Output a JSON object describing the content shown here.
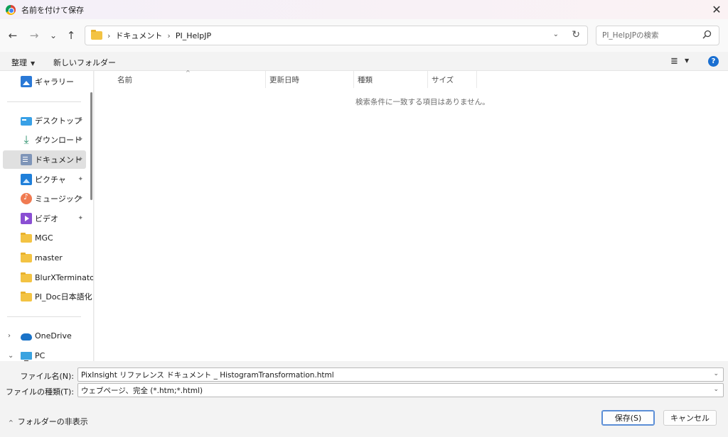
{
  "window": {
    "title": "名前を付けて保存",
    "close_glyph": "✕"
  },
  "nav": {
    "back_glyph": "←",
    "forward_glyph": "→",
    "recent_glyph": "⌄",
    "up_glyph": "↑",
    "breadcrumb": [
      "ドキュメント",
      "PI_HelpJP"
    ],
    "breadcrumb_sep": "›",
    "dropdown_glyph": "⌄",
    "refresh_glyph": "↻"
  },
  "search": {
    "placeholder": "PI_HelpJPの検索",
    "icon": "search-icon"
  },
  "commandbar": {
    "organize_label": "整理",
    "new_folder_label": "新しいフォルダー",
    "view_glyph": "≣",
    "help_glyph": "?"
  },
  "sidebar": {
    "items": [
      {
        "label": "ギャラリー",
        "icon": "gallery-icon",
        "pinned": false
      },
      {
        "label": "デスクトップ",
        "icon": "desktop-icon",
        "pinned": true
      },
      {
        "label": "ダウンロード",
        "icon": "download-icon",
        "pinned": true
      },
      {
        "label": "ドキュメント",
        "icon": "documents-icon",
        "pinned": true,
        "selected": true
      },
      {
        "label": "ピクチャ",
        "icon": "pictures-icon",
        "pinned": true
      },
      {
        "label": "ミュージック",
        "icon": "music-icon",
        "pinned": true
      },
      {
        "label": "ビデオ",
        "icon": "video-icon",
        "pinned": true
      },
      {
        "label": "MGC",
        "icon": "folder-icon"
      },
      {
        "label": "master",
        "icon": "folder-icon"
      },
      {
        "label": "BlurXTerminator",
        "icon": "folder-icon"
      },
      {
        "label": "PI_Doc日本語化",
        "icon": "folder-icon"
      },
      {
        "label": "OneDrive",
        "icon": "onedrive-icon",
        "expander": "›"
      },
      {
        "label": "PC",
        "icon": "pc-icon",
        "expander": "⌄"
      }
    ],
    "pin_glyph": "📌"
  },
  "file_list": {
    "columns": [
      "名前",
      "更新日時",
      "種類",
      "サイズ"
    ],
    "sort_glyph": "^",
    "empty_message": "検索条件に一致する項目はありません。"
  },
  "form": {
    "filename_label": "ファイル名(N):",
    "filename_value": "PixInsight リファレンス ドキュメント _ HistogramTransformation.html",
    "filetype_label": "ファイルの種類(T):",
    "filetype_value": "ウェブページ、完全 (*.htm;*.html)",
    "caret_glyph": "⌄"
  },
  "footer": {
    "hide_folders_label": "フォルダーの非表示",
    "hide_chevron": "^",
    "save_label": "保存(S)",
    "cancel_label": "キャンセル"
  }
}
